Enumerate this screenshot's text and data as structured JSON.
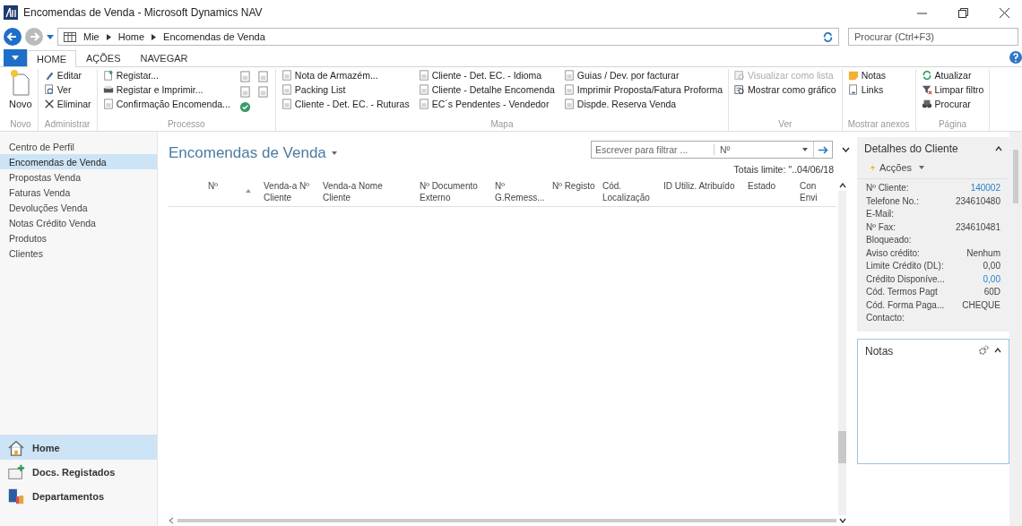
{
  "window": {
    "title": "Encomendas de Venda - Microsoft Dynamics NAV"
  },
  "address": {
    "crumbs": [
      "Mie",
      "Home",
      "Encomendas de Venda"
    ],
    "search_placeholder": "Procurar (Ctrl+F3)"
  },
  "ribbon_tabs": [
    {
      "label": "HOME",
      "selected": true
    },
    {
      "label": "AÇÕES",
      "selected": false
    },
    {
      "label": "NAVEGAR",
      "selected": false
    }
  ],
  "ribbon_groups": [
    {
      "label": "Novo",
      "large": {
        "label": "Novo"
      }
    },
    {
      "label": "Administrar",
      "columns": [
        [
          {
            "label": "Editar",
            "kind": "pencil",
            "disabled": false
          },
          {
            "label": "Ver",
            "kind": "view",
            "disabled": false
          },
          {
            "label": "Eliminar",
            "kind": "delete",
            "disabled": false
          }
        ]
      ]
    },
    {
      "label": "Processo",
      "columns": [
        [
          {
            "label": "Registar...",
            "kind": "post",
            "disabled": false
          },
          {
            "label": "Registar e Imprimir...",
            "kind": "print",
            "disabled": false
          },
          {
            "label": "Confirmação Encomenda...",
            "kind": "report",
            "disabled": false
          }
        ]
      ],
      "extra_icons": true
    },
    {
      "label": "Mapa",
      "columns": [
        [
          {
            "label": "Nota de Armazém...",
            "kind": "report",
            "disabled": false
          },
          {
            "label": "Packing List",
            "kind": "report",
            "disabled": false
          },
          {
            "label": "Cliente - Det. EC. - Ruturas",
            "kind": "report",
            "disabled": false
          }
        ],
        [
          {
            "label": "Cliente - Det. EC. - Idioma",
            "kind": "report",
            "disabled": false
          },
          {
            "label": "Cliente - Detalhe Encomenda",
            "kind": "report",
            "disabled": false
          },
          {
            "label": "EC´s Pendentes - Vendedor",
            "kind": "report",
            "disabled": false
          }
        ],
        [
          {
            "label": "Guias / Dev. por facturar",
            "kind": "report",
            "disabled": false
          },
          {
            "label": "Imprimir Proposta/Fatura Proforma",
            "kind": "report",
            "disabled": false
          },
          {
            "label": "Dispde. Reserva Venda",
            "kind": "report",
            "disabled": false
          }
        ]
      ]
    },
    {
      "label": "Ver",
      "columns": [
        [
          {
            "label": "Visualizar como lista",
            "kind": "list",
            "disabled": true
          },
          {
            "label": "Mostrar como gráfico",
            "kind": "chart",
            "disabled": false
          }
        ]
      ]
    },
    {
      "label": "Mostrar anexos",
      "columns": [
        [
          {
            "label": "Notas",
            "kind": "note",
            "disabled": false
          },
          {
            "label": "Links",
            "kind": "link",
            "disabled": false
          }
        ]
      ]
    },
    {
      "label": "Página",
      "columns": [
        [
          {
            "label": "Atualizar",
            "kind": "refresh",
            "disabled": false
          },
          {
            "label": "Limpar filtro",
            "kind": "filter",
            "disabled": false
          },
          {
            "label": "Procurar",
            "kind": "find",
            "disabled": false
          }
        ]
      ]
    }
  ],
  "sidebar": {
    "items": [
      {
        "label": "Centro de Perfil",
        "selected": false
      },
      {
        "label": "Encomendas de Venda",
        "selected": true
      },
      {
        "label": "Propostas Venda",
        "selected": false
      },
      {
        "label": "Faturas Venda",
        "selected": false
      },
      {
        "label": "Devoluções Venda",
        "selected": false
      },
      {
        "label": "Notas Crédito Venda",
        "selected": false
      },
      {
        "label": "Produtos",
        "selected": false
      },
      {
        "label": "Clientes",
        "selected": false
      }
    ],
    "sections": [
      {
        "label": "Home",
        "kind": "home",
        "selected": true
      },
      {
        "label": "Docs. Registados",
        "kind": "docs",
        "selected": false
      },
      {
        "label": "Departamentos",
        "kind": "depts",
        "selected": false
      }
    ]
  },
  "page": {
    "title": "Encomendas de Venda",
    "filter": {
      "placeholder": "Escrever para filtrar ...",
      "field": "Nº"
    },
    "totals": "Totais limite: ''..04/06/18"
  },
  "table": {
    "columns": [
      "Nº",
      "Venda-a Nº Cliente",
      "Venda-a Nome Cliente",
      "Nº Documento Externo",
      "Nº G.Remess...",
      "Nº Registo",
      "Cód. Localização",
      "ID Utiliz. Atribuído",
      "Estado",
      "Con Envi"
    ]
  },
  "factbox": {
    "title": "Detalhes do Cliente",
    "actions": "Acções",
    "fields": [
      {
        "label": "Nº Cliente:",
        "value": "140002",
        "link": true
      },
      {
        "label": "Telefone No.:",
        "value": "234610480",
        "link": false
      },
      {
        "label": "E-Mail:"
      },
      {
        "label": "Nº Fax:",
        "value": "234610481",
        "link": false
      },
      {
        "label": "Bloqueado:"
      },
      {
        "label": "Aviso crédito:",
        "value": "Nenhum",
        "link": false
      },
      {
        "label": "Limite Crédito (DL):",
        "value": "0,00",
        "link": false
      },
      {
        "label": "Crédito Disponíve...",
        "value": "0,00",
        "link": true
      },
      {
        "label": "Cód. Termos Pagt",
        "value": "60D",
        "link": false
      },
      {
        "label": "Cód. Forma Paga...",
        "value": "CHEQUE",
        "link": false
      },
      {
        "label": "Contacto:"
      }
    ],
    "notes_title": "Notas"
  }
}
